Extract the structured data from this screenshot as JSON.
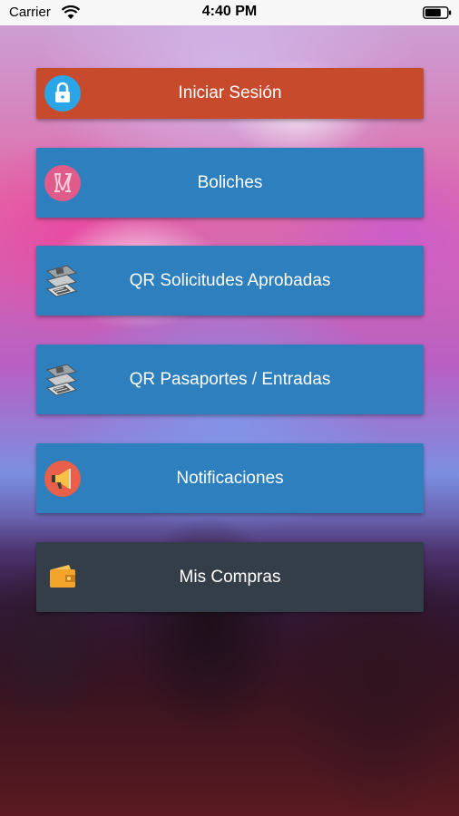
{
  "status_bar": {
    "carrier": "Carrier",
    "time": "4:40 PM",
    "wifi_icon": "wifi-icon",
    "battery_icon": "battery-icon"
  },
  "menu": {
    "items": [
      {
        "label": "Iniciar Sesión",
        "icon": "lock-icon",
        "color": "#c0392b"
      },
      {
        "label": "Boliches",
        "icon": "drinks-toast-icon",
        "color": "#2e86c1"
      },
      {
        "label": "QR Solicitudes Aprobadas",
        "icon": "ticket-stack-icon",
        "color": "#2e86c1"
      },
      {
        "label": "QR Pasaportes / Entradas",
        "icon": "ticket-stack-icon",
        "color": "#2e86c1"
      },
      {
        "label": "Notificaciones",
        "icon": "megaphone-icon",
        "color": "#2e86c1"
      },
      {
        "label": "Mis Compras",
        "icon": "wallet-icon",
        "color": "#34404b"
      }
    ]
  }
}
